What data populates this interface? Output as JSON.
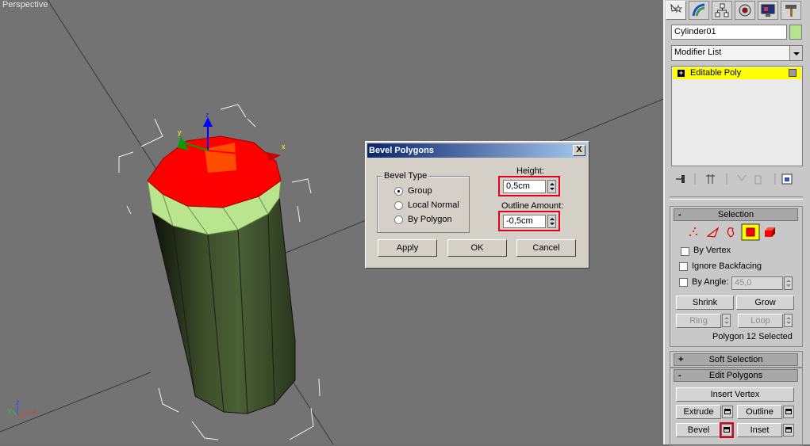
{
  "viewport": {
    "label": "Perspective",
    "gizmo": {
      "x": "x",
      "y": "y",
      "z": "z"
    },
    "axis_tripod": {
      "x": "x",
      "y": "y",
      "z": "z"
    }
  },
  "command_panel": {
    "tabs": [
      {
        "name": "create-tab",
        "icon": "star-cursor-icon"
      },
      {
        "name": "modify-tab",
        "icon": "rainbow-arc-icon"
      },
      {
        "name": "hierarchy-tab",
        "icon": "hierarchy-icon"
      },
      {
        "name": "motion-tab",
        "icon": "motion-wheel-icon"
      },
      {
        "name": "display-tab",
        "icon": "monitor-icon"
      },
      {
        "name": "utilities-tab",
        "icon": "hammer-icon"
      }
    ],
    "object_name": "Cylinder01",
    "object_color": "#b5e48f",
    "modifier_list_label": "Modifier List",
    "stack": [
      {
        "label": "Editable Poly",
        "expand": "+"
      }
    ],
    "selection": {
      "header": "Selection",
      "header_sign": "-",
      "by_vertex": "By Vertex",
      "ignore_backfacing": "Ignore Backfacing",
      "by_angle": "By Angle:",
      "by_angle_value": "45,0",
      "shrink": "Shrink",
      "grow": "Grow",
      "ring": "Ring",
      "loop": "Loop",
      "status": "Polygon 12 Selected"
    },
    "soft_selection": {
      "header": "Soft Selection",
      "sign": "+"
    },
    "edit_polygons": {
      "header": "Edit Polygons",
      "sign": "-",
      "insert_vertex": "Insert Vertex",
      "extrude": "Extrude",
      "outline": "Outline",
      "bevel": "Bevel",
      "inset": "Inset"
    }
  },
  "dialog": {
    "title": "Bevel Polygons",
    "close": "X",
    "bevel_type": {
      "title": "Bevel Type",
      "options": [
        "Group",
        "Local Normal",
        "By Polygon"
      ],
      "selected": "Group"
    },
    "height_label": "Height:",
    "height_value": "0,5cm",
    "outline_label": "Outline Amount:",
    "outline_value": "-0,5cm",
    "apply": "Apply",
    "ok": "OK",
    "cancel": "Cancel"
  },
  "colors": {
    "selected_face": "#ff0000",
    "cylinder": "#3d4f2c",
    "bevel_band": "#b9e58f",
    "highlight_red": "#e0001a",
    "stack_yellow": "#ffff00"
  }
}
